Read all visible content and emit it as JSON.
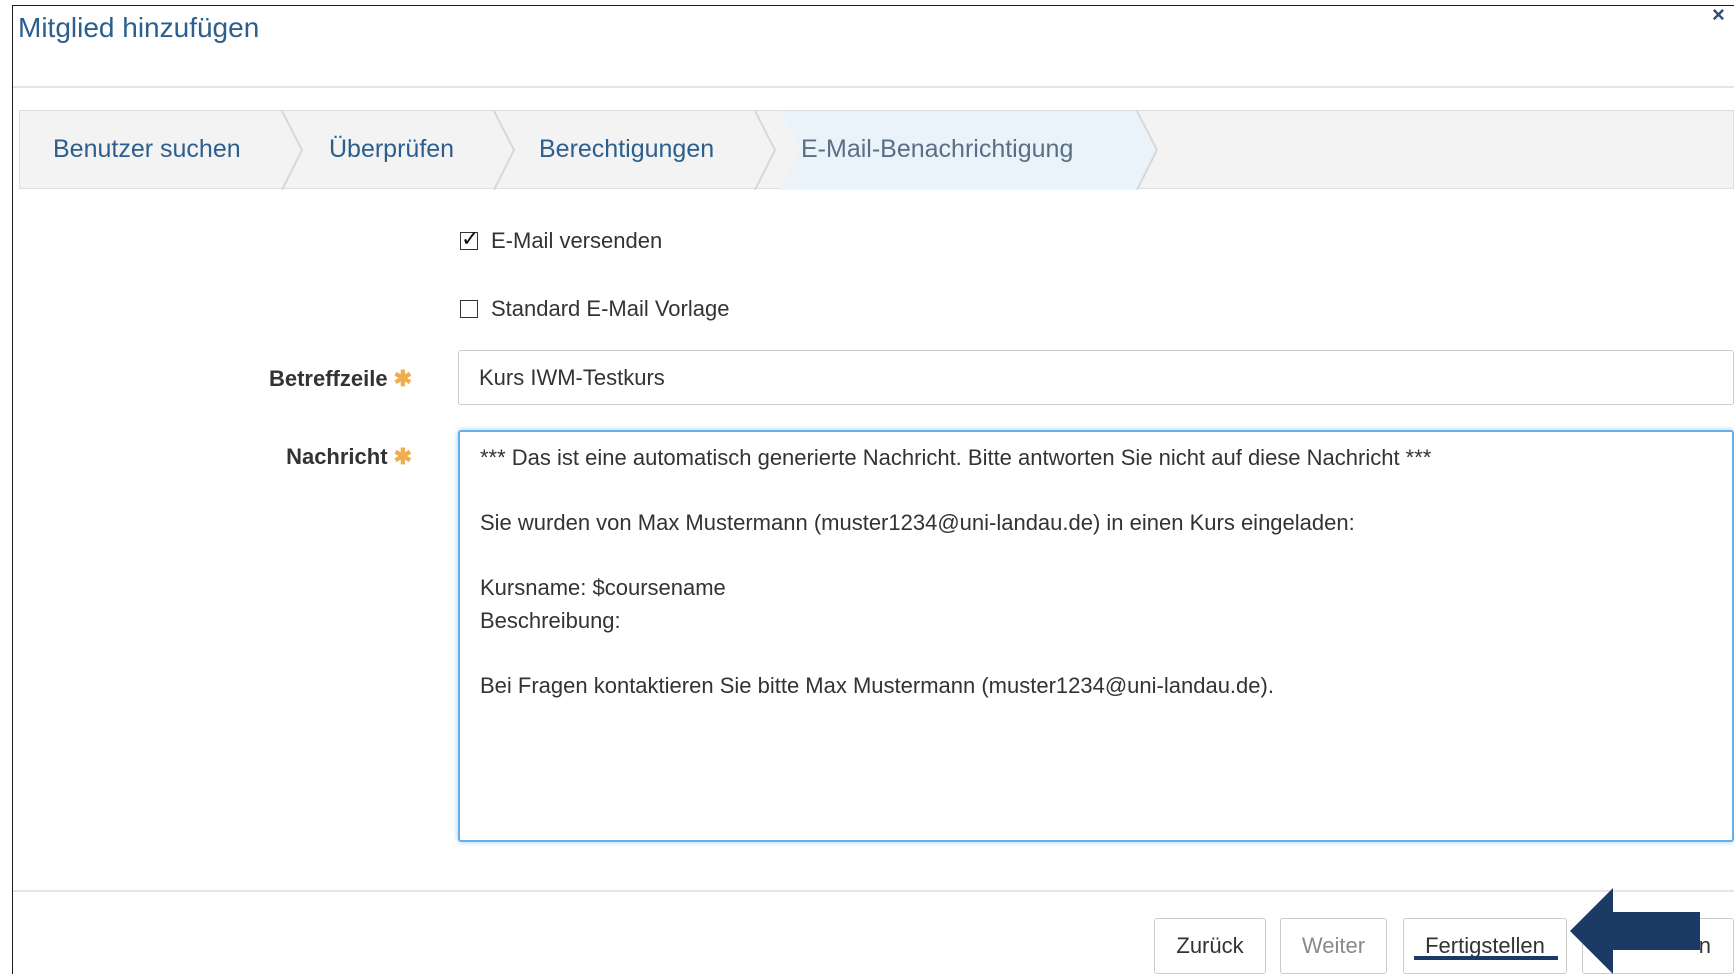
{
  "dialog": {
    "title": "Mitglied hinzufügen",
    "close_glyph": "×"
  },
  "wizard": {
    "steps": [
      {
        "label": "Benutzer suchen"
      },
      {
        "label": "Überprüfen"
      },
      {
        "label": "Berechtigungen"
      },
      {
        "label": "E-Mail-Benachrichtigung",
        "active": true
      }
    ]
  },
  "options": {
    "send_email": {
      "label": "E-Mail versenden",
      "checked": true
    },
    "standard_template": {
      "label": "Standard E-Mail Vorlage",
      "checked": false
    }
  },
  "fields": {
    "subject": {
      "label": "Betreffzeile",
      "required_mark": "✱",
      "value": "Kurs IWM-Testkurs"
    },
    "message": {
      "label": "Nachricht",
      "required_mark": "✱",
      "value": "*** Das ist eine automatisch generierte Nachricht. Bitte antworten Sie nicht auf diese Nachricht ***\n\nSie wurden von Max Mustermann (muster1234@uni-landau.de) in einen Kurs eingeladen:\n\nKursname: $coursename\nBeschreibung:\n\nBei Fragen kontaktieren Sie bitte Max Mustermann (muster1234@uni-landau.de)."
    }
  },
  "footer": {
    "back_label": "Zurück",
    "next_label": "Weiter",
    "finish_label": "Fertigstellen",
    "cancel_partial_label": "n"
  },
  "annotation": {
    "arrow_color": "#1b3a66"
  }
}
